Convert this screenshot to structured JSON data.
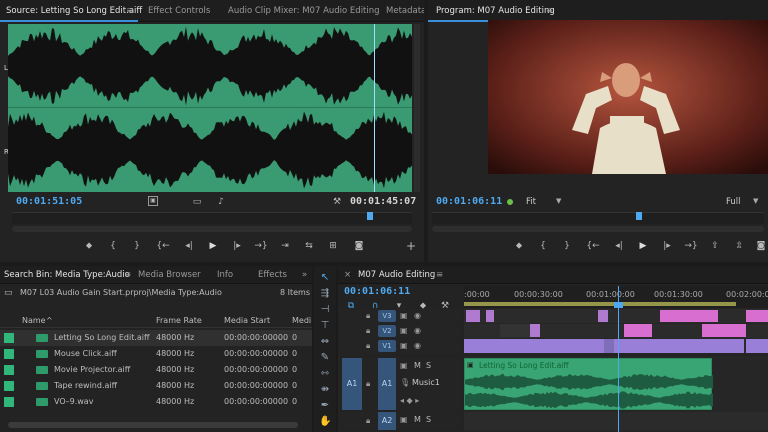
{
  "source": {
    "tabs": [
      "Source: Letting So Long Edit.aiff",
      "Effect Controls",
      "Audio Clip Mixer: M07 Audio Editing",
      "Metadata"
    ],
    "menu_glyph": "≡",
    "channel_labels": [
      "L",
      "R"
    ],
    "timecode_in": "00:01:51:05",
    "timecode_dur": "00:01:45:07",
    "colors": {
      "waveform_bg": "#3a9a72",
      "waveform": "#111"
    }
  },
  "program": {
    "tab": "Program: M07 Audio Editing",
    "timecode": "00:01:06:11",
    "fit": "Fit",
    "quality": "Full"
  },
  "project": {
    "tabs": [
      "Search Bin: Media Type:Audio",
      "Media Browser",
      "Info",
      "Effects"
    ],
    "path": "M07 L03 Audio Gain Start.prproj\\Media Type:Audio",
    "count": "8 Items",
    "columns": [
      "Name",
      "Frame Rate",
      "Media Start",
      "Medi"
    ],
    "items": [
      {
        "name": "Letting So Long Edit.aiff",
        "rate": "48000 Hz",
        "start": "00:00:00:00000",
        "extra": "0"
      },
      {
        "name": "Mouse Click.aiff",
        "rate": "48000 Hz",
        "start": "00:00:00:00000",
        "extra": "0"
      },
      {
        "name": "Movie Projector.aiff",
        "rate": "48000 Hz",
        "start": "00:00:00:00000",
        "extra": "0"
      },
      {
        "name": "Tape rewind.aiff",
        "rate": "48000 Hz",
        "start": "00:00:00:00000",
        "extra": "0"
      },
      {
        "name": "VO–9.wav",
        "rate": "48000 Hz",
        "start": "00:00:00:00000",
        "extra": "0"
      }
    ]
  },
  "timeline": {
    "tab": "M07 Audio Editing",
    "close": "×",
    "timecode": "00:01:06:11",
    "ruler": [
      ":00:00",
      "00:00:30:00",
      "00:01:00:00",
      "00:01:30:00",
      "00:02:00:0"
    ],
    "video_tracks": [
      "V3",
      "V2",
      "V1"
    ],
    "audio_tracks": [
      {
        "src": "A1",
        "name": "A1",
        "label": "Music1"
      },
      {
        "src": "",
        "name": "A2",
        "label": ""
      }
    ],
    "clip_name": "Letting So Long Edit.aiff",
    "m": "M",
    "s": "S"
  }
}
